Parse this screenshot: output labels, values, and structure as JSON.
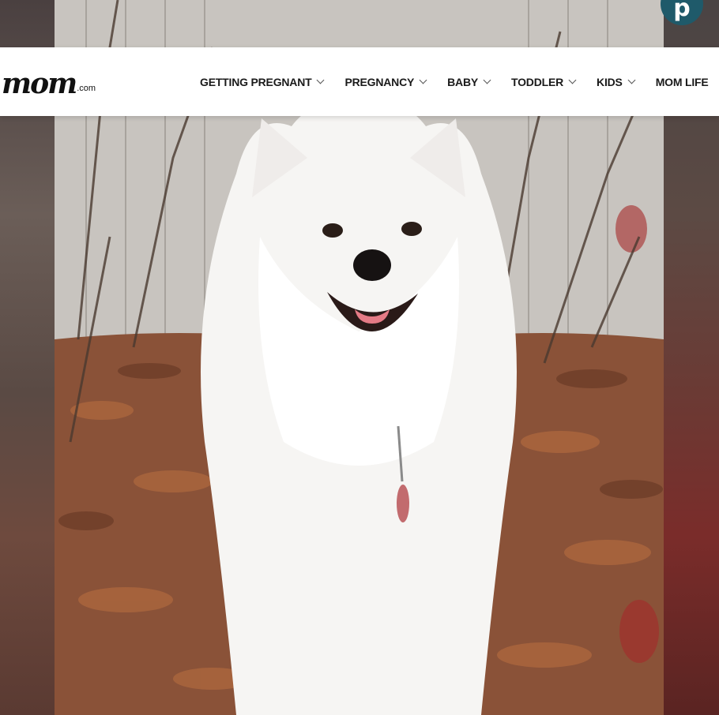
{
  "site": {
    "logo_text": "mom",
    "logo_suffix": ".com"
  },
  "share": {
    "pinterest_label": "p"
  },
  "nav": {
    "items": [
      {
        "label": "GETTING PREGNANT",
        "has_dropdown": true
      },
      {
        "label": "PREGNANCY",
        "has_dropdown": true
      },
      {
        "label": "BABY",
        "has_dropdown": true
      },
      {
        "label": "TODDLER",
        "has_dropdown": true
      },
      {
        "label": "KIDS",
        "has_dropdown": true
      },
      {
        "label": "MOM LIFE",
        "has_dropdown": false
      }
    ]
  },
  "hero_image": {
    "subject": "white fluffy dog sitting on autumn leaves in front of a fence"
  },
  "colors": {
    "pinterest_bg": "#1f5a6a",
    "nav_bg": "#ffffff",
    "nav_text": "#1a1a1a"
  }
}
